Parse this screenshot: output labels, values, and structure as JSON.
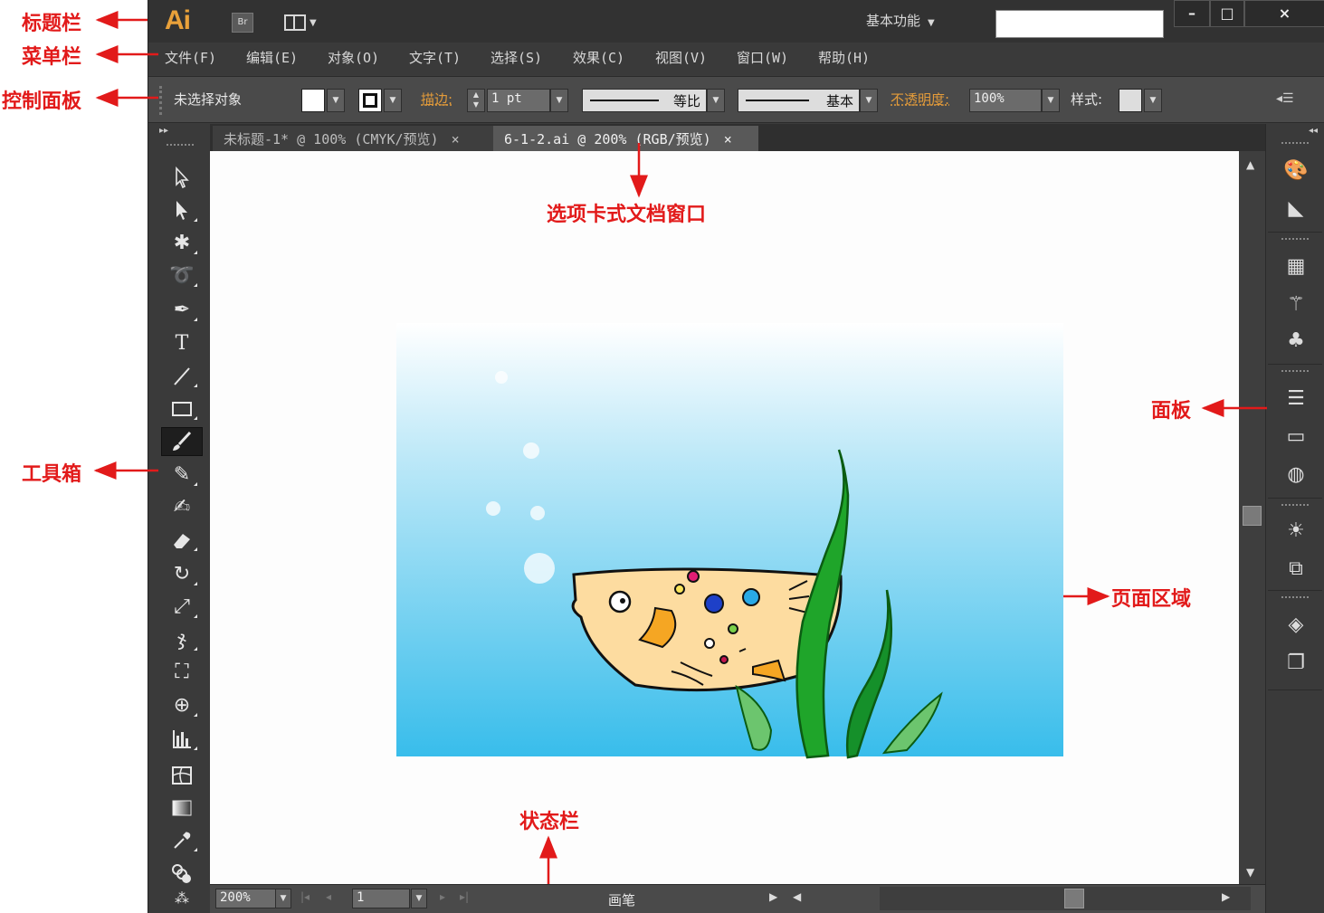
{
  "titlebar": {
    "logo": "Ai",
    "bridge_label": "Br",
    "workspace_label": "基本功能",
    "search_value": "",
    "window_controls": [
      "–",
      "□",
      "×"
    ]
  },
  "menubar": {
    "items": [
      "文件(F)",
      "编辑(E)",
      "对象(O)",
      "文字(T)",
      "选择(S)",
      "效果(C)",
      "视图(V)",
      "窗口(W)",
      "帮助(H)"
    ]
  },
  "control_panel": {
    "selection_label": "未选择对象",
    "stroke_label": "描边:",
    "stroke_weight": "1 pt",
    "profile_label": "等比",
    "brush_label": "基本",
    "opacity_label": "不透明度:",
    "opacity_value": "100%",
    "style_label": "样式:",
    "fill_color": "#ffffff"
  },
  "tabs": [
    {
      "label": "未标题-1* @ 100% (CMYK/预览)",
      "close": "×",
      "active": false
    },
    {
      "label": "6-1-2.ai @ 200% (RGB/预览)",
      "close": "×",
      "active": true
    }
  ],
  "toolbox": {
    "tools": [
      "selection-tool",
      "direct-selection-tool",
      "magic-wand-tool",
      "lasso-tool",
      "pen-tool",
      "type-tool",
      "line-segment-tool",
      "rectangle-tool",
      "paintbrush-tool",
      "pencil-tool",
      "blob-brush-tool",
      "eraser-tool",
      "rotate-tool",
      "scale-tool",
      "warp-tool",
      "free-transform-tool",
      "shape-builder-tool",
      "graph-tool",
      "mesh-tool",
      "gradient-tool",
      "eyedropper-tool",
      "blend-tool",
      "symbol-sprayer-tool"
    ],
    "active_tool": "paintbrush-tool",
    "type_tool_glyph": "T"
  },
  "status_bar": {
    "zoom": "200%",
    "page": "1",
    "current_tool": "画笔"
  },
  "dock": {
    "icons": [
      "color-guide-icon",
      "color-icon",
      "swatches-icon",
      "brushes-icon",
      "symbols-icon",
      "stroke-icon",
      "gradient-icon",
      "transparency-icon",
      "appearance-icon",
      "graphic-styles-icon",
      "layers-icon",
      "artboards-icon"
    ]
  },
  "annotations": {
    "title_bar": "标题栏",
    "menu_bar": "菜单栏",
    "control_panel": "控制面板",
    "toolbox": "工具箱",
    "tabbed_document": "选项卡式文档窗口",
    "panel": "面板",
    "page_area": "页面区域",
    "status_bar": "状态栏"
  },
  "colors": {
    "annotation": "#e21a1a",
    "accent_orange": "#e39b3a",
    "logo": "#e9a13a",
    "ocean_top": "#ffffff",
    "ocean_bottom": "#38bdeb",
    "fish_body": "#fddca0",
    "seaweed": "#1fa52a"
  }
}
